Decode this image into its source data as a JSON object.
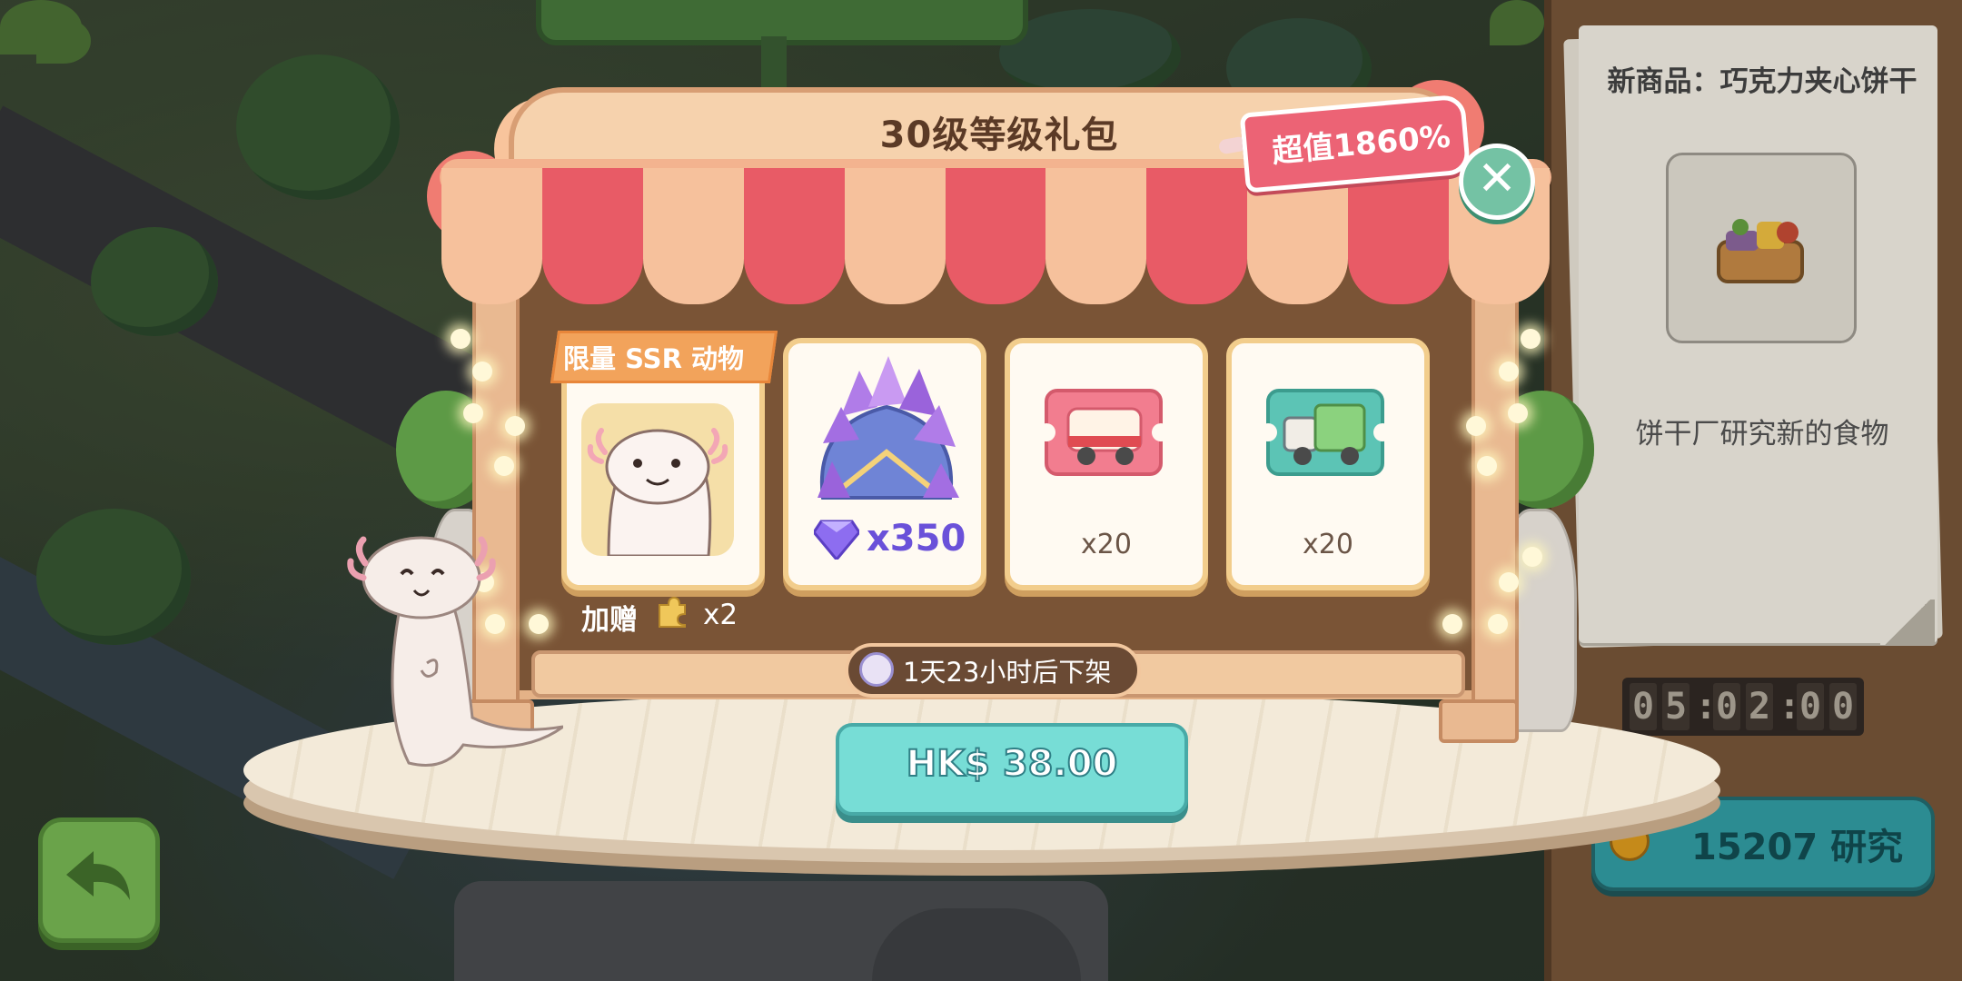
{
  "popup": {
    "title": "30级等级礼包",
    "value_tag": "超值1860%",
    "close_icon": "close-icon",
    "ssr_ribbon": "限量 SSR 动物",
    "items": [
      {
        "name": "axolotl-ssr-animal",
        "quantity": ""
      },
      {
        "name": "amethyst-gem-pile",
        "quantity": "x350"
      },
      {
        "name": "red-van-ticket",
        "quantity": "x20"
      },
      {
        "name": "green-truck-ticket",
        "quantity": "x20"
      }
    ],
    "bonus": {
      "label": "加赠",
      "count": "x2"
    },
    "countdown": "1天23小时后下架",
    "price": "HK$ 38.00"
  },
  "side_panel": {
    "title": "新商品：巧克力夹心饼干",
    "description": "饼干厂研究新的食物",
    "timer_digits": [
      "0",
      "5",
      ":",
      "0",
      "2",
      ":",
      "0",
      "0"
    ],
    "research_button": "15207 研究"
  },
  "nav": {
    "back_icon": "back-arrow-icon"
  },
  "colors": {
    "awning_red": "#e85b66",
    "awning_cream": "#f6c19c",
    "price_button": "#77ddd6",
    "value_tag": "#ec6375",
    "close_button": "#74c2a4",
    "gem_count": "#6a51d9"
  }
}
